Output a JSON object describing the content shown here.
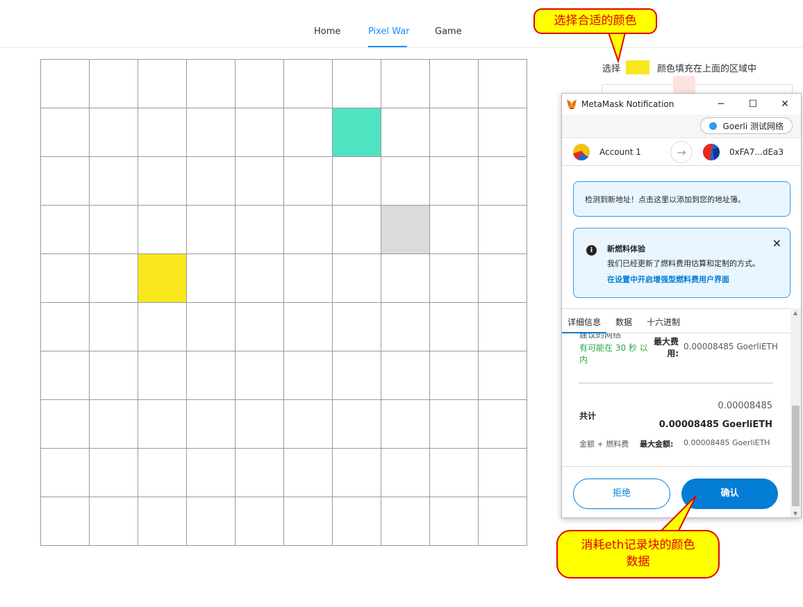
{
  "nav": {
    "tabs": [
      "Home",
      "Pixel War",
      "Game"
    ],
    "active_tab": "Pixel War"
  },
  "grid": {
    "rows": 10,
    "cols": 10,
    "colored_cells": [
      {
        "row": 1,
        "col": 6,
        "color": "#50e3c2"
      },
      {
        "row": 3,
        "col": 7,
        "color": "#dbdbdb"
      },
      {
        "row": 4,
        "col": 2,
        "color": "#f8e71c"
      }
    ]
  },
  "picker": {
    "prefix": "选择",
    "selected_color": "#f8e71c",
    "suffix": "颜色填充在上面的区域中"
  },
  "metamask": {
    "window_title": "MetaMask Notification",
    "network": "Goerli 测试网络",
    "from_account": "Account 1",
    "to_address": "0xFA7...dEa3",
    "notice_new_address": "检测到新地址！点击这里以添加到您的地址簿。",
    "gas_notice": {
      "title": "新燃料体验",
      "text": "我们已经更新了燃料费用估算和定制的方式。",
      "link": "在设置中开启增强型燃料费用户界面"
    },
    "tabs": [
      "详细信息",
      "数据",
      "十六进制"
    ],
    "details": {
      "cut_off_text": "建议的网络",
      "time_estimate": "有可能在 30 秒 以内",
      "max_fee_label": "最大费用:",
      "max_fee_value": "0.00008485 GoerliETH",
      "total_label": "共计",
      "total_value_top": "0.00008485",
      "total_value_bold": "0.00008485 GoerliETH",
      "amount_fee_label": "金额 + 燃料费",
      "max_amount_label": "最大金额:",
      "max_amount_value": "0.00008485 GoerliETH"
    },
    "buttons": {
      "reject": "拒绝",
      "confirm": "确认"
    }
  },
  "annotations": {
    "top": "选择合适的颜色",
    "bottom_line1": "消耗eth记录块的颜色",
    "bottom_line2": "数据"
  }
}
